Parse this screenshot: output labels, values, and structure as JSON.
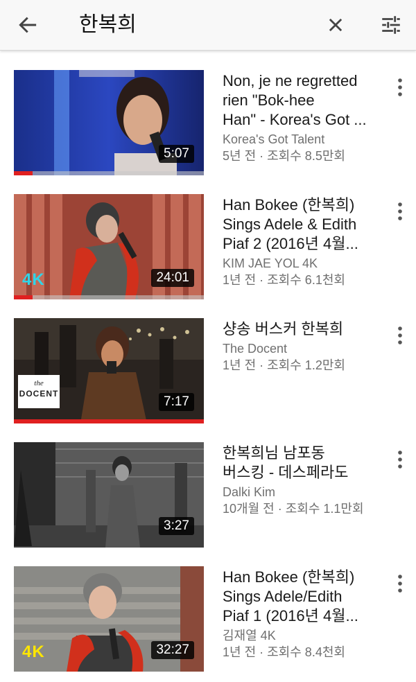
{
  "header": {
    "query": "한복희",
    "back_icon": "arrow-left-icon",
    "clear_icon": "close-icon",
    "filter_icon": "tune-icon"
  },
  "results": [
    {
      "title": "Non, je ne regretted\nrien \"Bok-hee\nHan\" - Korea's Got ...",
      "channel": "Korea's Got Talent",
      "stats": "5년 전 · 조회수 8.5만회",
      "duration": "5:07",
      "badge": "",
      "watched_fraction": 0.1
    },
    {
      "title": "Han Bokee (한복희)\nSings Adele & Edith\nPiaf 2 (2016년 4월...",
      "channel": "KIM JAE YOL 4K",
      "stats": "1년 전 · 조회수 6.1천회",
      "duration": "24:01",
      "badge": "4K",
      "watched_fraction": 0.1
    },
    {
      "title": "샹송 버스커 한복희",
      "channel": "The Docent",
      "stats": "1년 전 · 조회수 1.2만회",
      "duration": "7:17",
      "badge": "the DOCENT",
      "watched_fraction": 1.0
    },
    {
      "title": "한복희님 남포동\n버스킹 - 데스페라도",
      "channel": "Dalki Kim",
      "stats": "10개월 전 · 조회수 1.1만회",
      "duration": "3:27",
      "badge": "",
      "watched_fraction": 0
    },
    {
      "title": "Han Bokee (한복희)\nSings Adele/Edith\nPiaf 1 (2016년 4월...",
      "channel": "김재열 4K",
      "stats": "1년 전 · 조회수 8.4천회",
      "duration": "32:27",
      "badge": "4K",
      "watched_fraction": 0
    }
  ],
  "colors": {
    "progress": "#e02020",
    "badge_4k_cyan": "#2fd4e8",
    "badge_4k_yellow": "#ffe600"
  }
}
